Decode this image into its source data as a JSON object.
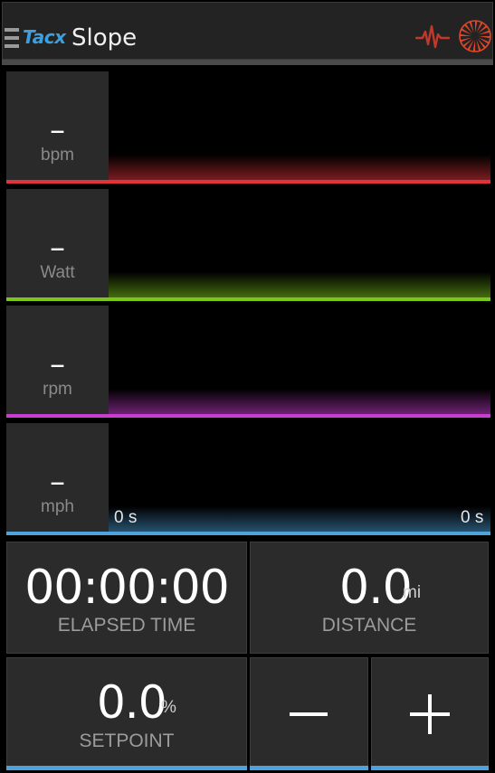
{
  "header": {
    "brand": "Tacx",
    "title": "Slope"
  },
  "metrics": [
    {
      "value": "–",
      "unit": "bpm",
      "color": "#e0343a"
    },
    {
      "value": "–",
      "unit": "Watt",
      "color": "#7cc61a"
    },
    {
      "value": "–",
      "unit": "rpm",
      "color": "#c83ed0"
    },
    {
      "value": "–",
      "unit": "mph",
      "color": "#4fa3dc"
    }
  ],
  "axis": {
    "start": "0 s",
    "end": "0 s"
  },
  "elapsed": {
    "value": "00:00:00",
    "label": "ELAPSED TIME"
  },
  "distance": {
    "value": "0.0",
    "unit": "mi",
    "label": "DISTANCE"
  },
  "setpoint": {
    "value": "0.0",
    "unit": "%",
    "label": "SETPOINT"
  },
  "colors": {
    "accent": "#4fa3dc",
    "brand": "#3aa0e0",
    "pulse": "#c0392b",
    "wheel": "#e0462a"
  }
}
